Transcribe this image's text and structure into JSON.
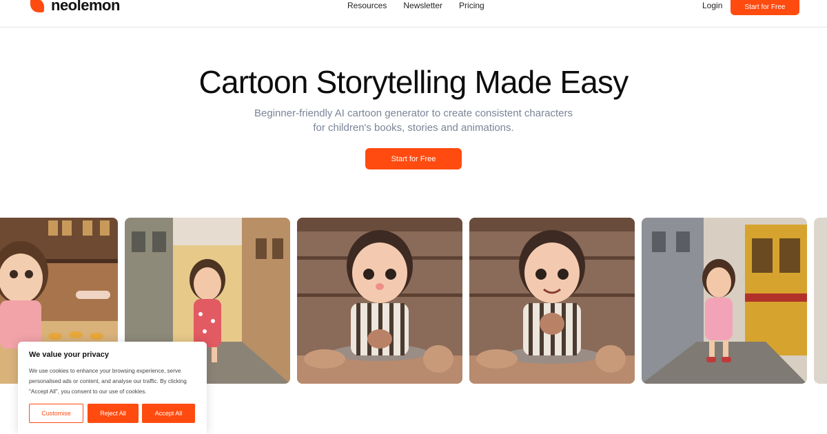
{
  "brand": {
    "name": "neolemon"
  },
  "nav": {
    "items": [
      {
        "label": "Resources"
      },
      {
        "label": "Newsletter"
      },
      {
        "label": "Pricing"
      }
    ],
    "login_label": "Login",
    "cta_label": "Start for Free"
  },
  "hero": {
    "title": "Cartoon Storytelling Made Easy",
    "subtitle_line1": "Beginner-friendly AI cartoon generator to create consistent characters",
    "subtitle_line2": "for children's books, stories and animations.",
    "cta_label": "Start for Free"
  },
  "cookie": {
    "title": "We value your privacy",
    "text": "We use cookies to enhance your browsing experience, serve personalised ads or content, and analyse our traffic. By clicking \"Accept All\", you consent to our use of cookies.",
    "customise_label": "Customise",
    "reject_label": "Reject All",
    "accept_label": "Accept All"
  },
  "colors": {
    "accent": "#ff4b10",
    "subtitle": "#7a8497"
  }
}
